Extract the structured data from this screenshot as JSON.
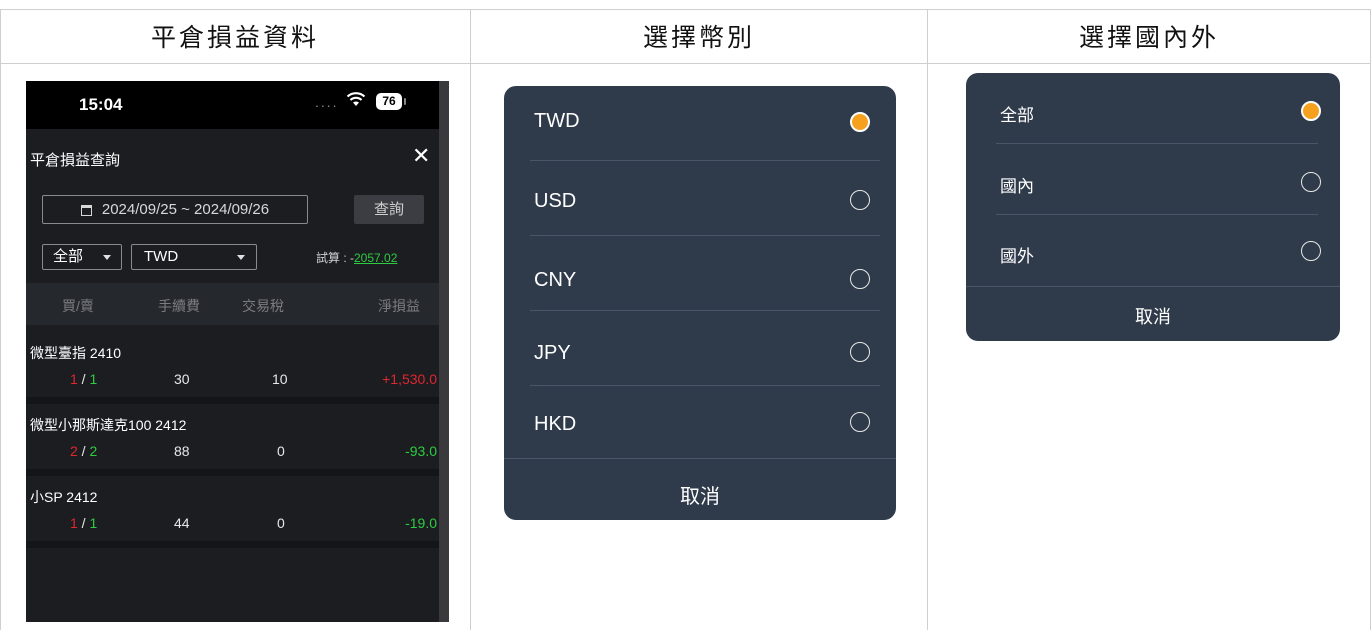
{
  "columns": [
    "平倉損益資料",
    "選擇幣別",
    "選擇國內外"
  ],
  "phone": {
    "status_time": "15:04",
    "status_signal": "....",
    "status_battery": "76",
    "title": "平倉損益查詢",
    "close": "✕",
    "date_range": "2024/09/25 ~ 2024/09/26",
    "query_button": "查詢",
    "region_select": "全部",
    "currency_select": "TWD",
    "trial_label": "試算 : -",
    "trial_value": "2057.02",
    "headers": [
      "買/賣",
      "手續費",
      "交易稅",
      "淨損益"
    ],
    "rows": [
      {
        "name": "微型臺指 2410",
        "buy": "1",
        "sell": "1",
        "fee": "30",
        "tax": "10",
        "net": "+1,530.0",
        "net_color": "#e0262e"
      },
      {
        "name": "微型小那斯達克100 2412",
        "buy": "2",
        "sell": "2",
        "fee": "88",
        "tax": "0",
        "net": "-93.0",
        "net_color": "#2ecc40"
      },
      {
        "name": "小SP 2412",
        "buy": "1",
        "sell": "1",
        "fee": "44",
        "tax": "0",
        "net": "-19.0",
        "net_color": "#2ecc40"
      }
    ]
  },
  "currency_picker": {
    "options": [
      "TWD",
      "USD",
      "CNY",
      "JPY",
      "HKD"
    ],
    "selected": "TWD",
    "cancel": "取消"
  },
  "region_picker": {
    "options": [
      "全部",
      "國內",
      "國外"
    ],
    "selected": "全部",
    "cancel": "取消"
  },
  "colors": {
    "accent": "#f5a11e",
    "picker_bg": "#2f3b4b",
    "phone_bg": "#1b1d21",
    "loss": "#2ecc40",
    "gain": "#e0262e"
  }
}
